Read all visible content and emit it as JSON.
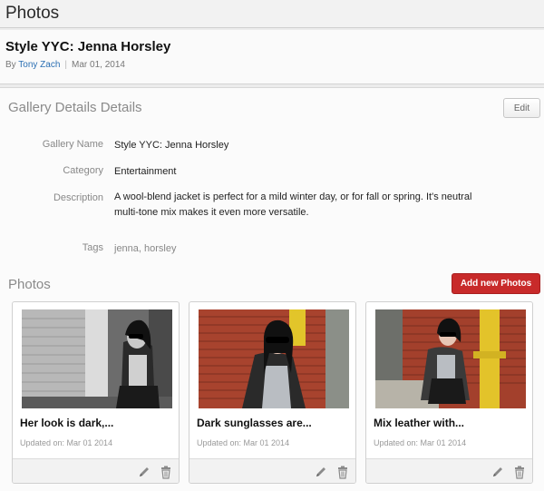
{
  "app": {
    "title": "Photos"
  },
  "gallery_header": {
    "title": "Style YYC: Jenna Horsley",
    "by_label": "By",
    "author": "Tony Zach",
    "date": "Mar 01, 2014"
  },
  "details": {
    "title": "Gallery Details Details",
    "edit_label": "Edit",
    "fields": {
      "name_label": "Gallery Name",
      "name_value": "Style YYC: Jenna Horsley",
      "category_label": "Category",
      "category_value": "Entertainment",
      "description_label": "Description",
      "description_line1": "A wool-blend jacket is perfect for a mild winter day, or for fall or spring. It's neutral",
      "description_line2": "multi-tone mix makes it even more versatile.",
      "tags_label": "Tags",
      "tags_value": "jenna, horsley"
    }
  },
  "photos": {
    "title": "Photos",
    "add_label": "Add new Photos",
    "cards": [
      {
        "title": "Her look is dark,...",
        "updated": "Updated on: Mar 01 2014"
      },
      {
        "title": "Dark sunglasses are...",
        "updated": "Updated on: Mar 01 2014"
      },
      {
        "title": "Mix leather with...",
        "updated": "Updated on: Mar 01 2014"
      }
    ]
  },
  "icons": {
    "edit": "pencil-icon",
    "delete": "trash-icon"
  },
  "colors": {
    "accent": "#c82a2a",
    "link": "#2a6fb3"
  }
}
